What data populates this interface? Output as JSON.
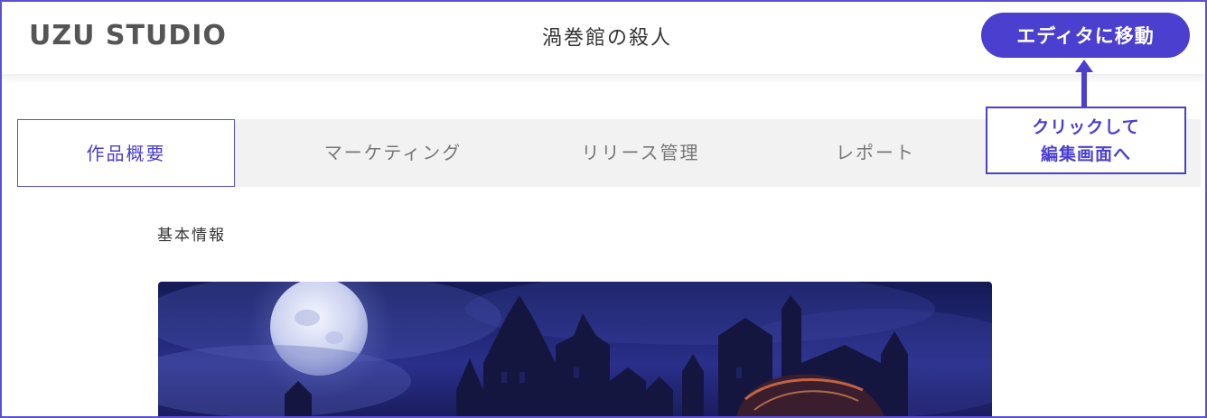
{
  "header": {
    "logo_text": "UZU STUDIO",
    "work_title": "渦巻館の殺人",
    "editor_button_label": "エディタに移動"
  },
  "tabs": [
    {
      "label": "作品概要",
      "active": true
    },
    {
      "label": "マーケティング",
      "active": false
    },
    {
      "label": "リリース管理",
      "active": false
    },
    {
      "label": "レポート",
      "active": false
    }
  ],
  "main": {
    "section_label": "基本情報",
    "cover_image_name": "cover-image-haunted-mansion"
  },
  "callout": {
    "line1": "クリックして",
    "line2": "編集画面へ"
  },
  "colors": {
    "accent": "#4b3fd0",
    "tabbar_bg": "#f2f2f2",
    "logo": "#555555"
  }
}
